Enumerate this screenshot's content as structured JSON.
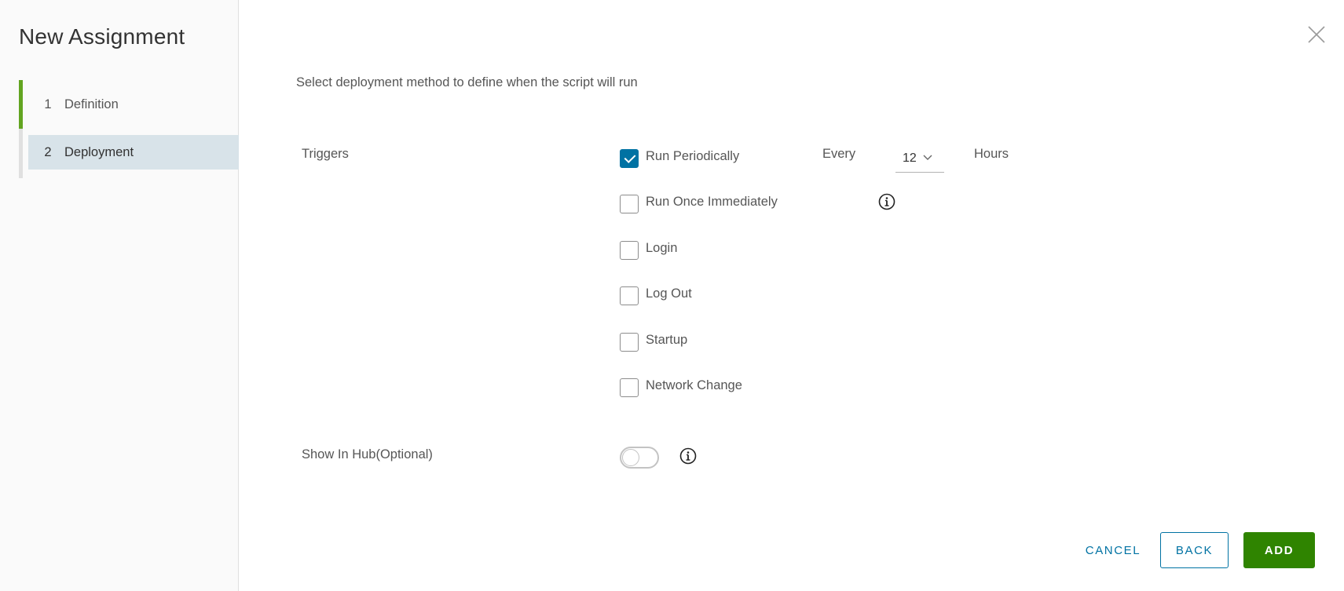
{
  "wizard": {
    "title": "New Assignment",
    "steps": [
      {
        "number": "1",
        "label": "Definition"
      },
      {
        "number": "2",
        "label": "Deployment"
      }
    ]
  },
  "main": {
    "intro": "Select deployment method to define when the script will run",
    "triggers_label": "Triggers",
    "triggers": [
      {
        "label": "Run Periodically",
        "checked": true
      },
      {
        "label": "Run Once Immediately",
        "checked": false
      },
      {
        "label": "Login",
        "checked": false
      },
      {
        "label": "Log Out",
        "checked": false
      },
      {
        "label": "Startup",
        "checked": false
      },
      {
        "label": "Network Change",
        "checked": false
      }
    ],
    "periodic": {
      "every_label": "Every",
      "interval_value": "12",
      "unit_label": "Hours"
    },
    "show_in_hub_label": "Show In Hub(Optional)",
    "show_in_hub_enabled": false
  },
  "footer": {
    "cancel_label": "CANCEL",
    "back_label": "BACK",
    "add_label": "ADD"
  },
  "colors": {
    "accent_blue": "#0072a3",
    "primary_green": "#2f8400",
    "step_done_green": "#62a420",
    "active_step_bg": "#d8e3e9"
  }
}
